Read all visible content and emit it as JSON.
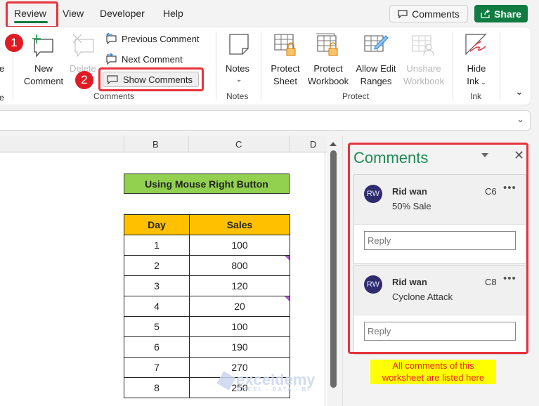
{
  "tabs": [
    {
      "label": "Review",
      "active": true
    },
    {
      "label": "View"
    },
    {
      "label": "Developer"
    },
    {
      "label": "Help"
    }
  ],
  "header_buttons": {
    "comments": "Comments",
    "share": "Share"
  },
  "step_badges": [
    "1",
    "2"
  ],
  "ribbon": {
    "partial_left": {
      "line1": "e",
      "line2": "e"
    },
    "new_comment": {
      "line1": "New",
      "line2": "Comment"
    },
    "delete": {
      "label": "Delete"
    },
    "previous_comment": "Previous Comment",
    "next_comment": "Next Comment",
    "show_comments": "Show Comments",
    "comments_group": "Comments",
    "notes": {
      "label": "Notes",
      "group": "Notes"
    },
    "protect_sheet": {
      "line1": "Protect",
      "line2": "Sheet"
    },
    "protect_workbook": {
      "line1": "Protect",
      "line2": "Workbook"
    },
    "allow_edit_ranges": {
      "line1": "Allow Edit",
      "line2": "Ranges"
    },
    "unshare_workbook": {
      "line1": "Unshare",
      "line2": "Workbook"
    },
    "protect_group": "Protect",
    "hide_ink": {
      "line1": "Hide",
      "line2": "Ink"
    },
    "ink_group": "Ink"
  },
  "grid": {
    "columns": [
      "B",
      "C",
      "D"
    ],
    "title": "Using Mouse Right Button",
    "headers": [
      "Day",
      "Sales"
    ],
    "rows": [
      {
        "day": "1",
        "sales": "100",
        "comment": false
      },
      {
        "day": "2",
        "sales": "800",
        "comment": true
      },
      {
        "day": "3",
        "sales": "120",
        "comment": false
      },
      {
        "day": "4",
        "sales": "20",
        "comment": true
      },
      {
        "day": "5",
        "sales": "100",
        "comment": false
      },
      {
        "day": "6",
        "sales": "190",
        "comment": false
      },
      {
        "day": "7",
        "sales": "270",
        "comment": false
      },
      {
        "day": "8",
        "sales": "250",
        "comment": false
      }
    ],
    "watermark": {
      "name": "exceldemy",
      "tagline": "EXCEL · DATA · BI"
    }
  },
  "comments_pane": {
    "title": "Comments",
    "items": [
      {
        "initials": "RW",
        "author": "Rid wan",
        "cell": "C6",
        "text": "50% Sale",
        "reply_placeholder": "Reply"
      },
      {
        "initials": "RW",
        "author": "Rid wan",
        "cell": "C8",
        "text": "Cyclone Attack",
        "reply_placeholder": "Reply"
      }
    ],
    "annotation": "All comments of this worksheet are listed here"
  },
  "colors": {
    "accent": "#107c41",
    "highlight": "#e8323c",
    "title_fill": "#92d050",
    "header_fill": "#ffc000",
    "comment_indicator": "#b05cc8"
  }
}
